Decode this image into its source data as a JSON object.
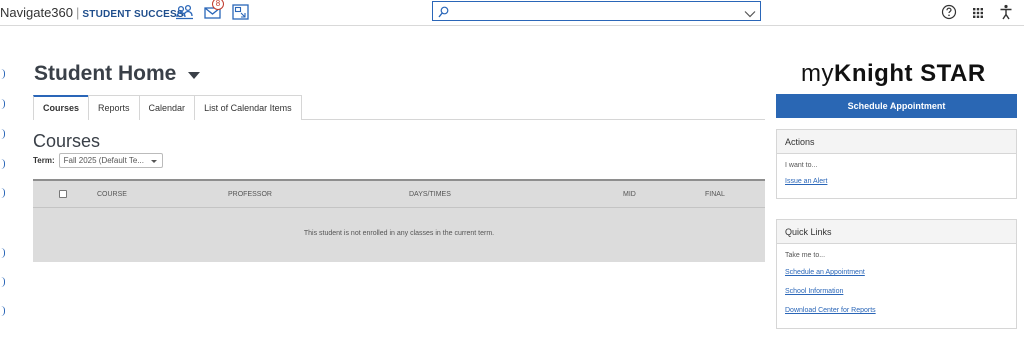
{
  "topbar": {
    "brand_name": "Navigate360",
    "brand_sep": "|",
    "brand_product": "STUDENT SUCCESS",
    "mail_badge": "8",
    "search_placeholder": "",
    "icons": [
      "students-icon",
      "mail-icon",
      "grid-icon",
      "search-icon",
      "chevron-down-icon",
      "help-icon",
      "apps-icon",
      "accessibility-icon"
    ]
  },
  "page": {
    "title": "Student Home"
  },
  "tabs": [
    {
      "label": "Courses",
      "active": true
    },
    {
      "label": "Reports",
      "active": false
    },
    {
      "label": "Calendar",
      "active": false
    },
    {
      "label": "List of Calendar Items",
      "active": false
    }
  ],
  "courses": {
    "section_title": "Courses",
    "term_label": "Term:",
    "term_value": "Fall 2025 (Default Te...",
    "columns": [
      "COURSE",
      "PROFESSOR",
      "DAYS/TIMES",
      "MID",
      "FINAL"
    ],
    "empty_message": "This student is not enrolled in any classes in the current term."
  },
  "sidebar": {
    "logo_prefix": "my",
    "logo_bold": "Knight STAR",
    "schedule_button": "Schedule Appointment",
    "actions": {
      "title": "Actions",
      "subtitle": "I want to...",
      "links": [
        "Issue an Alert"
      ]
    },
    "quick_links": {
      "title": "Quick Links",
      "subtitle": "Take me to...",
      "links": [
        "Schedule an Appointment",
        "School Information",
        "Download Center for Reports"
      ]
    }
  },
  "colors": {
    "accent": "#2a67b4",
    "grid_bg": "#dcdcdc",
    "badge": "#c0392b"
  }
}
